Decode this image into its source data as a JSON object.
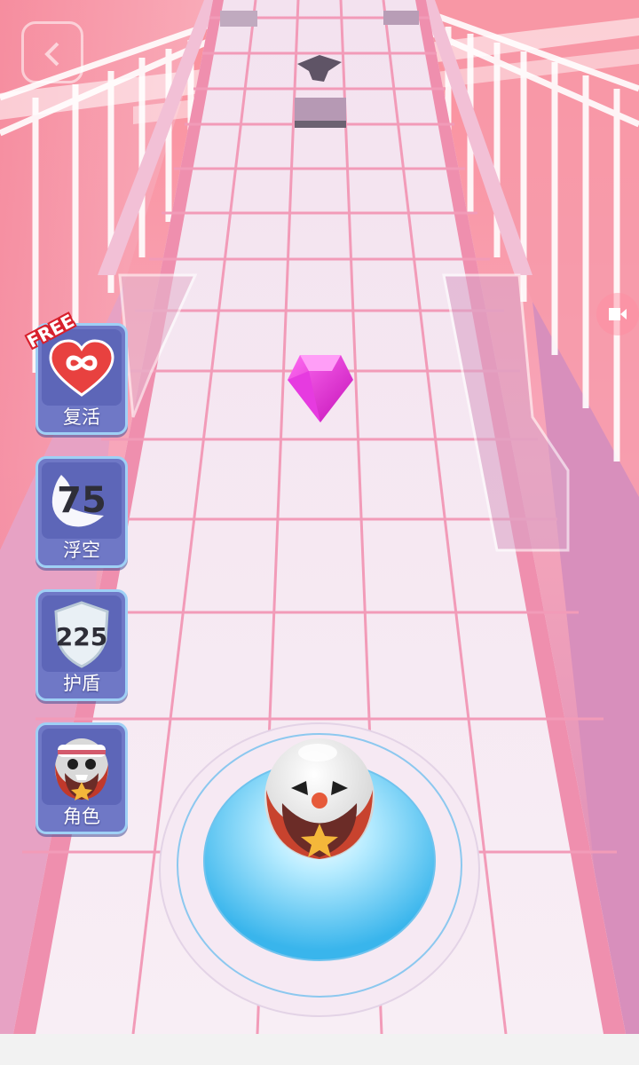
{
  "powerups": [
    {
      "label": "复活",
      "icon": "infinity-heart-icon",
      "badge": "FREE"
    },
    {
      "label": "浮空",
      "icon": "wing-icon",
      "count": "75"
    },
    {
      "label": "护盾",
      "icon": "shield-icon",
      "count": "225"
    },
    {
      "label": "角色",
      "icon": "character-icon"
    }
  ],
  "colors": {
    "track": "#f6e6f0",
    "grid_line": "#f08aaa",
    "background": "#f4b8c8",
    "gem": "#e02ad0",
    "pad": "#4fc3f0",
    "panel": "#6f78c6"
  }
}
